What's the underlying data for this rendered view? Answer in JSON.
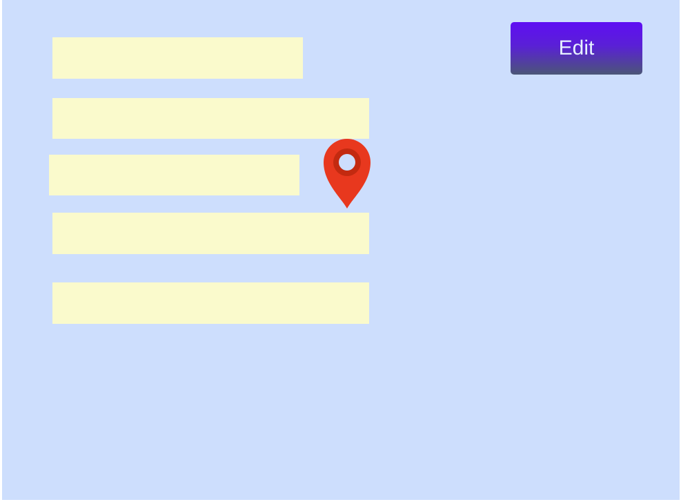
{
  "toolbar": {
    "edit_label": "Edit"
  },
  "icons": {
    "marker": "map-pin-icon"
  },
  "colors": {
    "background": "#cddefd",
    "placeholder_bar": "#fafacc",
    "button_top": "#5f0ef3",
    "button_bottom": "#4b5677",
    "button_text": "#e6f0ff",
    "pin": "#e8381e",
    "pin_ring": "#c32a10"
  }
}
